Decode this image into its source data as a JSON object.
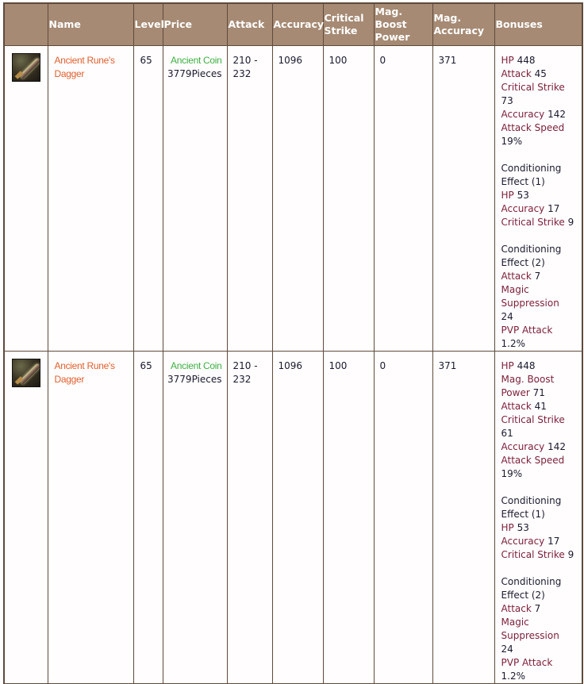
{
  "table": {
    "headers": {
      "icon": "",
      "name": "Name",
      "level": "Level",
      "price": "Price",
      "attack": "Attack",
      "accuracy": "Accuracy",
      "critical_strike": "Critical Strike",
      "mag_boost_power": "Mag. Boost Power",
      "mag_accuracy": "Mag. Accuracy",
      "bonuses": "Bonuses"
    },
    "rows": [
      {
        "icon": "dagger-icon",
        "name_line1": "Ancient Rune's",
        "name_line2": "Dagger",
        "level": "65",
        "price_label": "Ancient Coin",
        "price_amount": "3779Pieces",
        "attack_line1": "210 -",
        "attack_line2": "232",
        "accuracy": "1096",
        "critical_strike": "100",
        "mag_boost_power": "0",
        "mag_accuracy": "371",
        "bonuses": {
          "base": [
            {
              "label": "HP",
              "value": "448"
            },
            {
              "label": "Attack",
              "value": "45"
            },
            {
              "label": "Critical Strike",
              "value": "73"
            },
            {
              "label": "Accuracy",
              "value": "142"
            },
            {
              "label": "Attack Speed",
              "value": "19%"
            }
          ],
          "conditioning_1": {
            "title": "Conditioning Effect (1)",
            "items": [
              {
                "label": "HP",
                "value": "53"
              },
              {
                "label": "Accuracy",
                "value": "17"
              },
              {
                "label": "Critical Strike",
                "value": "9"
              }
            ]
          },
          "conditioning_2": {
            "title": "Conditioning Effect (2)",
            "items": [
              {
                "label": "Attack",
                "value": "7"
              },
              {
                "label": "Magic Suppression",
                "value": "24"
              },
              {
                "label": "PVP Attack",
                "value": "1.2%"
              }
            ]
          }
        }
      },
      {
        "icon": "dagger-icon",
        "name_line1": "Ancient Rune's",
        "name_line2": "Dagger",
        "level": "65",
        "price_label": "Ancient Coin",
        "price_amount": "3779Pieces",
        "attack_line1": "210 -",
        "attack_line2": "232",
        "accuracy": "1096",
        "critical_strike": "100",
        "mag_boost_power": "0",
        "mag_accuracy": "371",
        "bonuses": {
          "base": [
            {
              "label": "HP",
              "value": "448"
            },
            {
              "label": "Mag. Boost Power",
              "value": "71"
            },
            {
              "label": "Attack",
              "value": "41"
            },
            {
              "label": "Critical Strike",
              "value": "61"
            },
            {
              "label": "Accuracy",
              "value": "142"
            },
            {
              "label": "Attack Speed",
              "value": "19%"
            }
          ],
          "conditioning_1": {
            "title": "Conditioning Effect (1)",
            "items": [
              {
                "label": "HP",
                "value": "53"
              },
              {
                "label": "Accuracy",
                "value": "17"
              },
              {
                "label": "Critical Strike",
                "value": "9"
              }
            ]
          },
          "conditioning_2": {
            "title": "Conditioning Effect (2)",
            "items": [
              {
                "label": "Attack",
                "value": "7"
              },
              {
                "label": "Magic Suppression",
                "value": "24"
              },
              {
                "label": "PVP Attack",
                "value": "1.2%"
              }
            ]
          }
        }
      }
    ]
  },
  "colors": {
    "header_bg": "#a68a74",
    "border": "#5e4b3c",
    "item_name": "#e0602f",
    "price_label": "#3cb043",
    "bonus_label": "#7b1e3a"
  }
}
